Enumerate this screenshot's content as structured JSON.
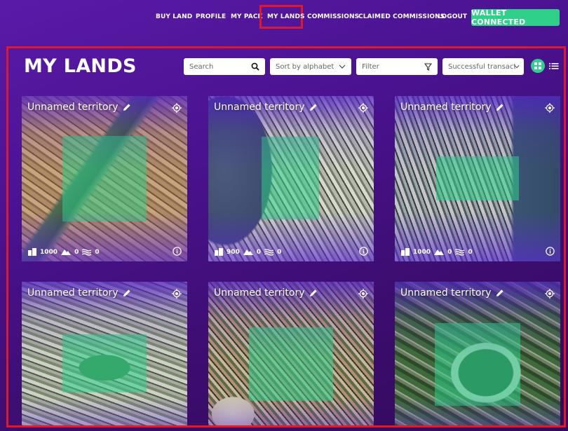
{
  "nav": {
    "items": [
      "BUY LAND",
      "PROFILE",
      "MY PACK",
      "MY LANDS",
      "COMMISSIONS",
      "CLAIMED COMMISSIONS",
      "LOGOUT"
    ],
    "wallet_label": "WALLET CONNECTED",
    "active_item": "MY LANDS",
    "accent_color": "#2fd08a",
    "highlight_color": "#e0182b"
  },
  "page": {
    "title": "MY LANDS",
    "search_placeholder": "Search",
    "sort_label": "Sort by alphabet",
    "filter_label": "Filter",
    "transaction_label": "Successful transaction"
  },
  "icons": {
    "search": "search-icon",
    "sort": "chevron-down-icon",
    "filter": "funnel-icon",
    "grid_view": "grid-icon",
    "list_view": "list-icon",
    "edit": "pencil-icon",
    "locate": "target-icon",
    "buildings": "building-icon",
    "mountains": "mountain-icon",
    "water": "water-icon",
    "info": "info-icon"
  },
  "lands": [
    {
      "name": "Unnamed territory",
      "buildings": "1000",
      "mountains": "0",
      "water": "0"
    },
    {
      "name": "Unnamed territory",
      "buildings": "900",
      "mountains": "0",
      "water": "0"
    },
    {
      "name": "Unnamed territory",
      "buildings": "1000",
      "mountains": "0",
      "water": "0"
    },
    {
      "name": "Unnamed territory",
      "buildings": "",
      "mountains": "",
      "water": ""
    },
    {
      "name": "Unnamed territory",
      "buildings": "",
      "mountains": "",
      "water": ""
    },
    {
      "name": "Unnamed territory",
      "buildings": "",
      "mountains": "",
      "water": ""
    }
  ]
}
